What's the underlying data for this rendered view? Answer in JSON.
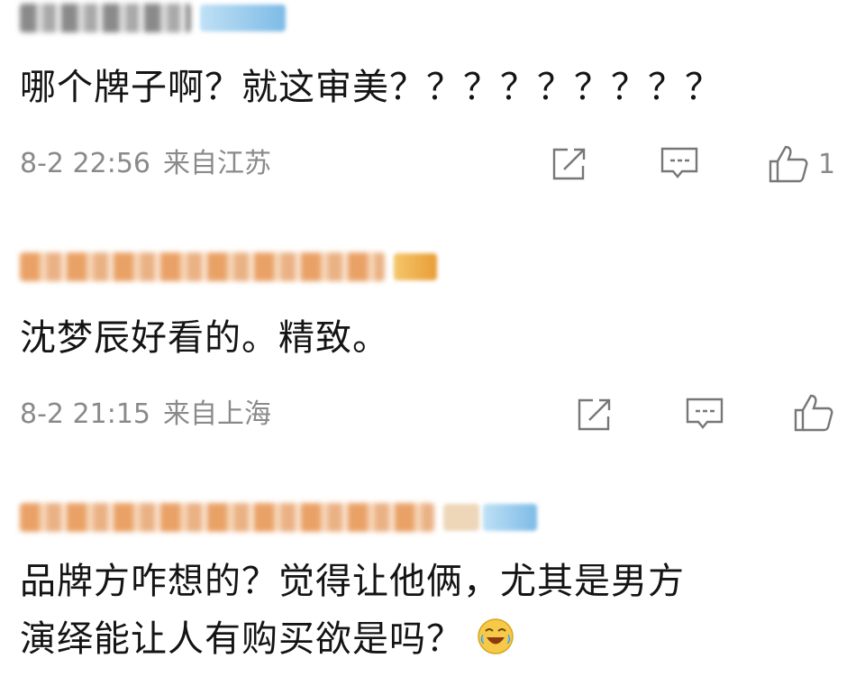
{
  "comments": [
    {
      "text": "哪个牌子啊？就这审美？？？？？？？？？",
      "time": "8-2 22:56",
      "location": "来自江苏",
      "like_count": "1"
    },
    {
      "text": "沈梦辰好看的。精致。",
      "time": "8-2 21:15",
      "location": "来自上海",
      "like_count": ""
    },
    {
      "text_line1": "品牌方咋想的？觉得让他俩，尤其是男方",
      "text_line2": "演绎能让人有购买欲是吗？"
    }
  ],
  "icons": {
    "share": "share-icon",
    "comment": "comment-icon",
    "like": "thumbs-up-icon",
    "emoji": "laughing-crying-emoji-icon"
  },
  "colors": {
    "text": "#141414",
    "meta": "#8a8a8a",
    "username_orange": "#e9a166"
  }
}
